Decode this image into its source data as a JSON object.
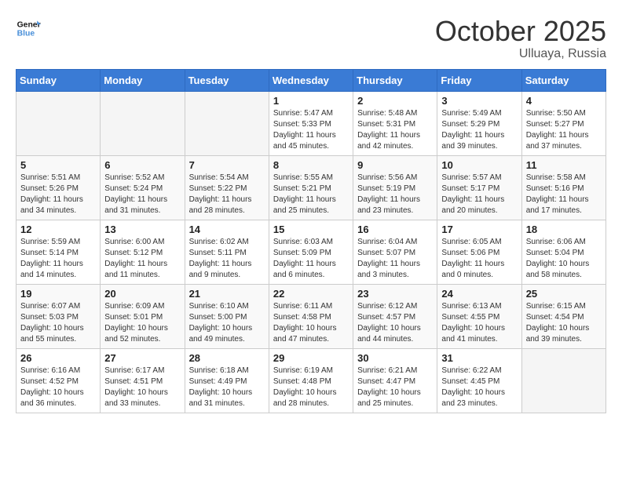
{
  "header": {
    "logo_line1": "General",
    "logo_line2": "Blue",
    "month": "October 2025",
    "location": "Ulluaya, Russia"
  },
  "weekdays": [
    "Sunday",
    "Monday",
    "Tuesday",
    "Wednesday",
    "Thursday",
    "Friday",
    "Saturday"
  ],
  "weeks": [
    [
      {
        "day": "",
        "info": ""
      },
      {
        "day": "",
        "info": ""
      },
      {
        "day": "",
        "info": ""
      },
      {
        "day": "1",
        "info": "Sunrise: 5:47 AM\nSunset: 5:33 PM\nDaylight: 11 hours\nand 45 minutes."
      },
      {
        "day": "2",
        "info": "Sunrise: 5:48 AM\nSunset: 5:31 PM\nDaylight: 11 hours\nand 42 minutes."
      },
      {
        "day": "3",
        "info": "Sunrise: 5:49 AM\nSunset: 5:29 PM\nDaylight: 11 hours\nand 39 minutes."
      },
      {
        "day": "4",
        "info": "Sunrise: 5:50 AM\nSunset: 5:27 PM\nDaylight: 11 hours\nand 37 minutes."
      }
    ],
    [
      {
        "day": "5",
        "info": "Sunrise: 5:51 AM\nSunset: 5:26 PM\nDaylight: 11 hours\nand 34 minutes."
      },
      {
        "day": "6",
        "info": "Sunrise: 5:52 AM\nSunset: 5:24 PM\nDaylight: 11 hours\nand 31 minutes."
      },
      {
        "day": "7",
        "info": "Sunrise: 5:54 AM\nSunset: 5:22 PM\nDaylight: 11 hours\nand 28 minutes."
      },
      {
        "day": "8",
        "info": "Sunrise: 5:55 AM\nSunset: 5:21 PM\nDaylight: 11 hours\nand 25 minutes."
      },
      {
        "day": "9",
        "info": "Sunrise: 5:56 AM\nSunset: 5:19 PM\nDaylight: 11 hours\nand 23 minutes."
      },
      {
        "day": "10",
        "info": "Sunrise: 5:57 AM\nSunset: 5:17 PM\nDaylight: 11 hours\nand 20 minutes."
      },
      {
        "day": "11",
        "info": "Sunrise: 5:58 AM\nSunset: 5:16 PM\nDaylight: 11 hours\nand 17 minutes."
      }
    ],
    [
      {
        "day": "12",
        "info": "Sunrise: 5:59 AM\nSunset: 5:14 PM\nDaylight: 11 hours\nand 14 minutes."
      },
      {
        "day": "13",
        "info": "Sunrise: 6:00 AM\nSunset: 5:12 PM\nDaylight: 11 hours\nand 11 minutes."
      },
      {
        "day": "14",
        "info": "Sunrise: 6:02 AM\nSunset: 5:11 PM\nDaylight: 11 hours\nand 9 minutes."
      },
      {
        "day": "15",
        "info": "Sunrise: 6:03 AM\nSunset: 5:09 PM\nDaylight: 11 hours\nand 6 minutes."
      },
      {
        "day": "16",
        "info": "Sunrise: 6:04 AM\nSunset: 5:07 PM\nDaylight: 11 hours\nand 3 minutes."
      },
      {
        "day": "17",
        "info": "Sunrise: 6:05 AM\nSunset: 5:06 PM\nDaylight: 11 hours\nand 0 minutes."
      },
      {
        "day": "18",
        "info": "Sunrise: 6:06 AM\nSunset: 5:04 PM\nDaylight: 10 hours\nand 58 minutes."
      }
    ],
    [
      {
        "day": "19",
        "info": "Sunrise: 6:07 AM\nSunset: 5:03 PM\nDaylight: 10 hours\nand 55 minutes."
      },
      {
        "day": "20",
        "info": "Sunrise: 6:09 AM\nSunset: 5:01 PM\nDaylight: 10 hours\nand 52 minutes."
      },
      {
        "day": "21",
        "info": "Sunrise: 6:10 AM\nSunset: 5:00 PM\nDaylight: 10 hours\nand 49 minutes."
      },
      {
        "day": "22",
        "info": "Sunrise: 6:11 AM\nSunset: 4:58 PM\nDaylight: 10 hours\nand 47 minutes."
      },
      {
        "day": "23",
        "info": "Sunrise: 6:12 AM\nSunset: 4:57 PM\nDaylight: 10 hours\nand 44 minutes."
      },
      {
        "day": "24",
        "info": "Sunrise: 6:13 AM\nSunset: 4:55 PM\nDaylight: 10 hours\nand 41 minutes."
      },
      {
        "day": "25",
        "info": "Sunrise: 6:15 AM\nSunset: 4:54 PM\nDaylight: 10 hours\nand 39 minutes."
      }
    ],
    [
      {
        "day": "26",
        "info": "Sunrise: 6:16 AM\nSunset: 4:52 PM\nDaylight: 10 hours\nand 36 minutes."
      },
      {
        "day": "27",
        "info": "Sunrise: 6:17 AM\nSunset: 4:51 PM\nDaylight: 10 hours\nand 33 minutes."
      },
      {
        "day": "28",
        "info": "Sunrise: 6:18 AM\nSunset: 4:49 PM\nDaylight: 10 hours\nand 31 minutes."
      },
      {
        "day": "29",
        "info": "Sunrise: 6:19 AM\nSunset: 4:48 PM\nDaylight: 10 hours\nand 28 minutes."
      },
      {
        "day": "30",
        "info": "Sunrise: 6:21 AM\nSunset: 4:47 PM\nDaylight: 10 hours\nand 25 minutes."
      },
      {
        "day": "31",
        "info": "Sunrise: 6:22 AM\nSunset: 4:45 PM\nDaylight: 10 hours\nand 23 minutes."
      },
      {
        "day": "",
        "info": ""
      }
    ]
  ]
}
